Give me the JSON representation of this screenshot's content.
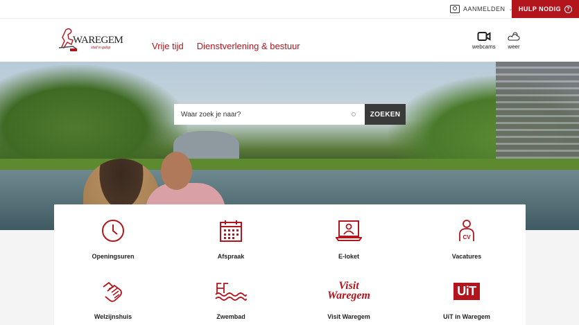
{
  "topbar": {
    "login_label": "AANMELDEN",
    "login_caret": "⌄",
    "help_label": "HULP NODIG",
    "help_icon": "?"
  },
  "header": {
    "logo": {
      "wordmark": "WAREGEM",
      "tagline": "stad in galop"
    },
    "nav": [
      "Vrije tijd",
      "Dienstverlening & bestuur"
    ],
    "tools": [
      {
        "label": "webcams",
        "icon": "camera-icon"
      },
      {
        "label": "weer",
        "icon": "weather-icon"
      }
    ]
  },
  "search": {
    "placeholder": "Waar zoek je naar?",
    "button_label": "ZOEKEN"
  },
  "tiles": [
    {
      "label": "Openingsuren",
      "icon": "clock-icon"
    },
    {
      "label": "Afspraak",
      "icon": "calendar-icon"
    },
    {
      "label": "E-loket",
      "icon": "laptop-user-icon"
    },
    {
      "label": "Vacatures",
      "icon": "cv-icon"
    },
    {
      "label": "Welzijnshuis",
      "icon": "hands-icon"
    },
    {
      "label": "Zwembad",
      "icon": "swimming-icon"
    },
    {
      "label": "Visit Waregem",
      "icon": "visit-waregem-logo",
      "logo_text": [
        "Visit",
        "Waregem"
      ]
    },
    {
      "label": "UiT in Waregem",
      "icon": "uit-logo",
      "logo_text": "UiT"
    }
  ],
  "colors": {
    "accent": "#b3151c",
    "dark_button": "#3a3a3a"
  }
}
